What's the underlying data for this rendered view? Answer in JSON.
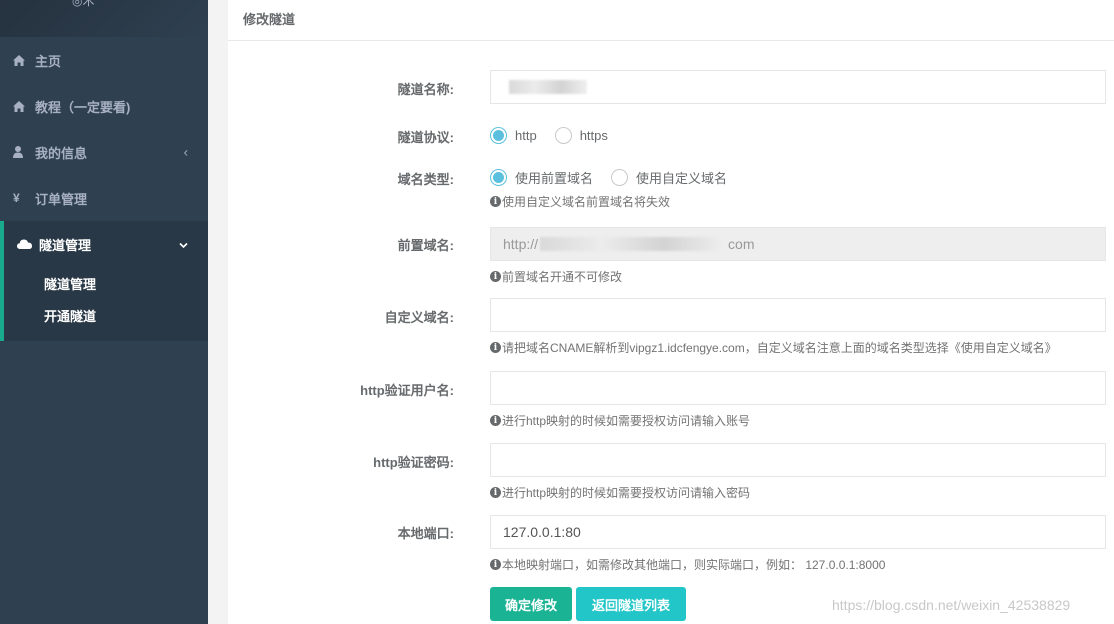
{
  "sidebar": {
    "brand_fragment": "◎术",
    "items": [
      {
        "label": "主页",
        "icon": "home-icon"
      },
      {
        "label": "教程（一定要看)",
        "icon": "home-icon"
      },
      {
        "label": "我的信息",
        "icon": "user-icon",
        "chevron": "‹"
      },
      {
        "label": "订单管理",
        "icon": "yen-icon"
      }
    ],
    "active_group": {
      "label": "隧道管理",
      "icon": "cloud-icon",
      "chevron": "⌄",
      "subitems": [
        "隧道管理",
        "开通隧道"
      ]
    }
  },
  "panel": {
    "title": "修改隧道"
  },
  "form": {
    "tunnel_name": {
      "label": "隧道名称:",
      "value": ""
    },
    "protocol": {
      "label": "隧道协议:",
      "options": [
        "http",
        "https"
      ],
      "selected": "http"
    },
    "domain_type": {
      "label": "域名类型:",
      "options": [
        "使用前置域名",
        "使用自定义域名"
      ],
      "selected": "使用前置域名",
      "help": "使用自定义域名前置域名将失效"
    },
    "front_domain": {
      "label": "前置域名:",
      "value_prefix": "http://",
      "value_suffix": "com",
      "help": "前置域名开通不可修改"
    },
    "custom_domain": {
      "label": "自定义域名:",
      "value": "",
      "help": "请把域名CNAME解析到vipgz1.idcfengye.com，自定义域名注意上面的域名类型选择《使用自定义域名》"
    },
    "http_user": {
      "label": "http验证用户名:",
      "value": "",
      "help": "进行http映射的时候如需要授权访问请输入账号"
    },
    "http_pass": {
      "label": "http验证密码:",
      "value": "",
      "help": "进行http映射的时候如需要授权访问请输入密码"
    },
    "local_port": {
      "label": "本地端口:",
      "value": "127.0.0.1:80",
      "help": "本地映射端口，如需修改其他端口，则实际端口，例如： 127.0.0.1:8000"
    }
  },
  "buttons": {
    "confirm": "确定修改",
    "back": "返回隧道列表"
  },
  "watermark": "https://blog.csdn.net/weixin_42538829",
  "colors": {
    "sidebar_bg": "#2f4050",
    "primary": "#1ab394",
    "info": "#23c6c8",
    "radio_accent": "#5bc0de"
  }
}
